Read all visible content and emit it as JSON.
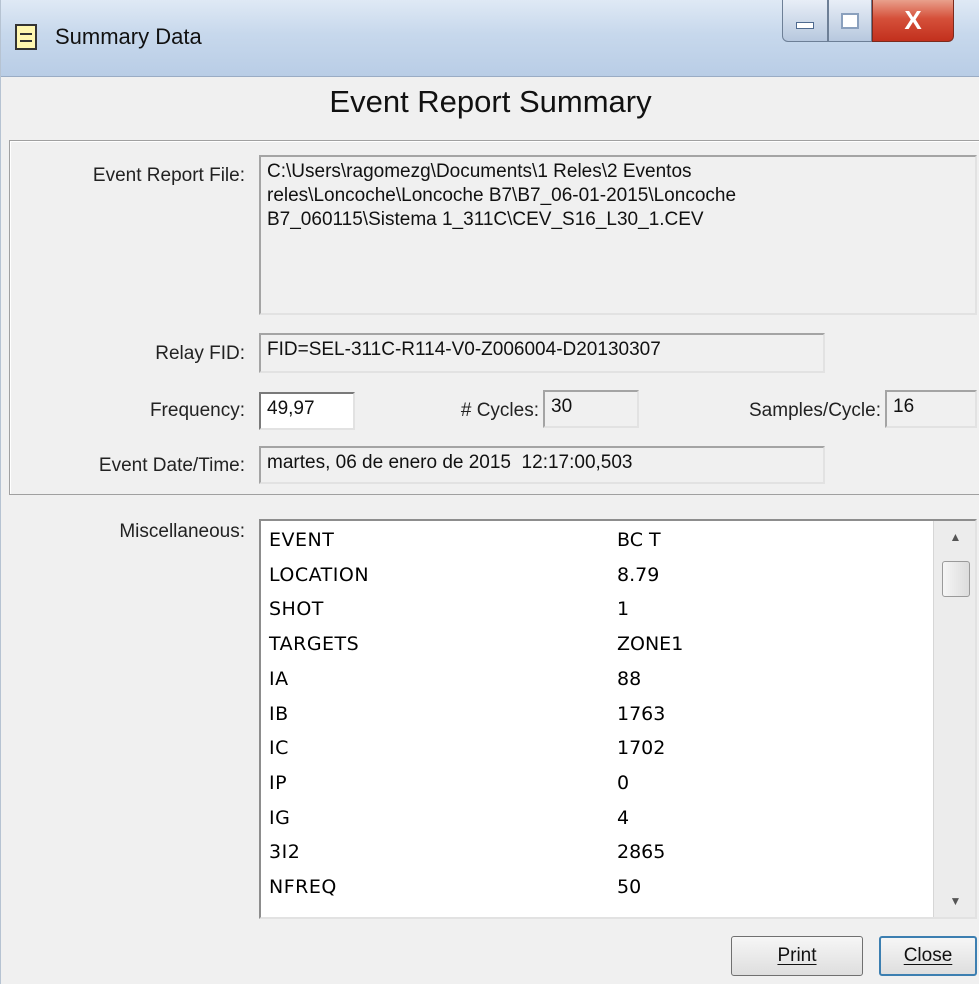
{
  "window": {
    "title": "Summary Data",
    "min_icon": "minimize-icon",
    "max_icon": "maximize-icon",
    "close_icon": "close-icon",
    "close_glyph": "X"
  },
  "header": {
    "title": "Event Report Summary"
  },
  "fields": {
    "event_report_file_label": "Event Report File:",
    "event_report_file_value": "C:\\Users\\ragomezg\\Documents\\1 Reles\\2 Eventos\nreles\\Loncoche\\Loncoche B7\\B7_06-01-2015\\Loncoche\nB7_060115\\Sistema 1_311C\\CEV_S16_L30_1.CEV",
    "relay_fid_label": "Relay FID:",
    "relay_fid_value": "FID=SEL-311C-R114-V0-Z006004-D20130307",
    "frequency_label": "Frequency:",
    "frequency_value": "49,97",
    "cycles_label": "# Cycles:",
    "cycles_value": "30",
    "samples_label": "Samples/Cycle:",
    "samples_value": "16",
    "event_datetime_label": "Event Date/Time:",
    "event_datetime_value": "martes, 06 de enero de 2015  12:17:00,503"
  },
  "misc": {
    "label": "Miscellaneous:",
    "rows": [
      {
        "key": "EVENT",
        "value": "BC T"
      },
      {
        "key": "LOCATION",
        "value": "8.79"
      },
      {
        "key": "SHOT",
        "value": "1"
      },
      {
        "key": "TARGETS",
        "value": "ZONE1"
      },
      {
        "key": "IA",
        "value": "88"
      },
      {
        "key": "IB",
        "value": "1763"
      },
      {
        "key": "IC",
        "value": "1702"
      },
      {
        "key": "IP",
        "value": "0"
      },
      {
        "key": "IG",
        "value": "4"
      },
      {
        "key": "3I2",
        "value": "2865"
      },
      {
        "key": "NFREQ",
        "value": "50"
      }
    ]
  },
  "buttons": {
    "print": "Print",
    "close": "Close"
  },
  "colors": {
    "close_button": "#c2301d",
    "window_bg": "#f0f0f0",
    "focus_border": "#3c7fb1"
  }
}
